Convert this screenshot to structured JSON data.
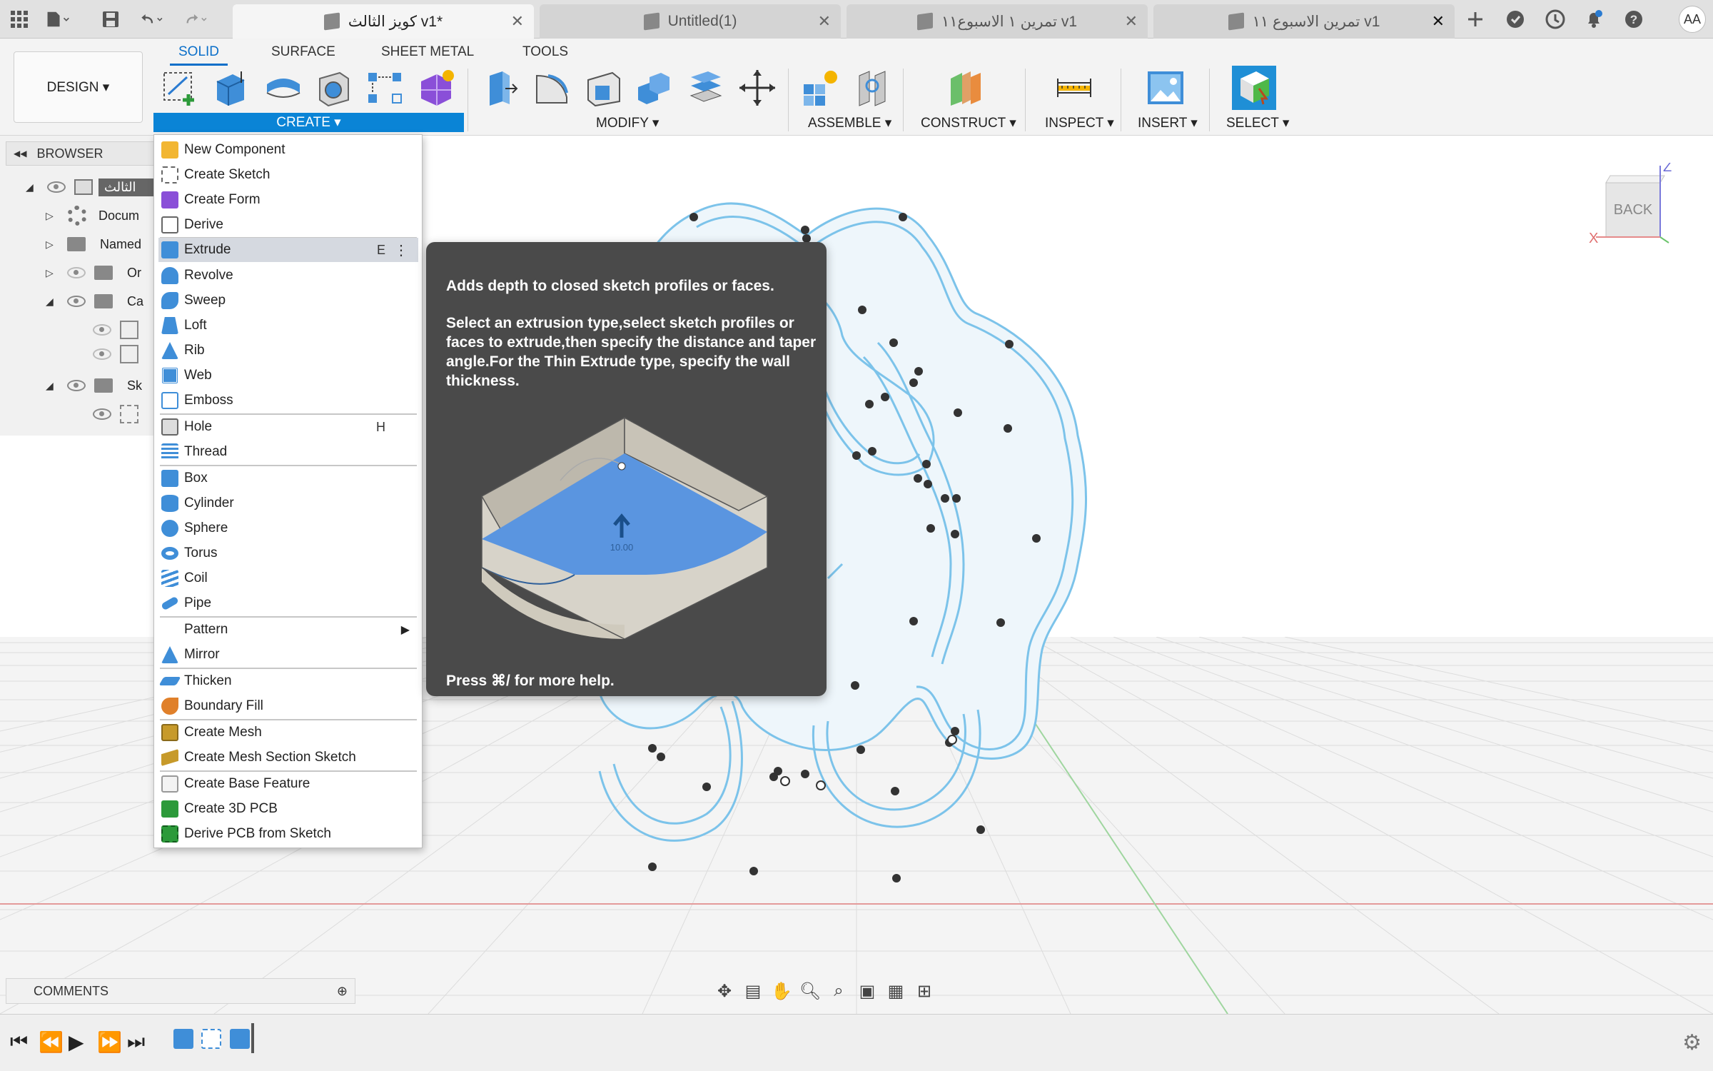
{
  "titlebar": {
    "tabs": [
      {
        "label": "كويز الثالث v1*",
        "active": true
      },
      {
        "label": "Untitled(1)",
        "active": false
      },
      {
        "label": "تمرين ١ الاسبوع١١ v1",
        "active": false
      },
      {
        "label": "تمرين الاسبوع ١١ v1",
        "active": false
      }
    ],
    "close_glyph": "✕",
    "user_initials": "AA"
  },
  "toolbar": {
    "tabs": [
      "SOLID",
      "SURFACE",
      "SHEET METAL",
      "TOOLS"
    ],
    "active_tab": "SOLID",
    "workspace": "DESIGN ▾",
    "groups": {
      "create": "CREATE ▾",
      "modify": "MODIFY ▾",
      "assemble": "ASSEMBLE ▾",
      "construct": "CONSTRUCT ▾",
      "inspect": "INSPECT ▾",
      "insert": "INSERT ▾",
      "select": "SELECT ▾"
    }
  },
  "browser": {
    "title": "BROWSER",
    "collapse_glyph": "◀◀",
    "items": [
      {
        "label": "الثالث",
        "expanded": true
      },
      {
        "label": "Docum"
      },
      {
        "label": "Named"
      },
      {
        "label": "Or"
      },
      {
        "label": "Ca"
      },
      {
        "label": "Sk"
      }
    ]
  },
  "create_menu": {
    "items": [
      {
        "label": "New Component",
        "icon": "new-component-icon",
        "color": "#f2b632"
      },
      {
        "label": "Create Sketch",
        "icon": "sketch-icon",
        "color": "#2c9a3a"
      },
      {
        "label": "Create Form",
        "icon": "form-icon",
        "color": "#8a4fd8"
      },
      {
        "label": "Derive",
        "icon": "derive-icon",
        "color": "#666666"
      },
      {
        "label": "Extrude",
        "icon": "extrude-icon",
        "color": "#3f8ed8",
        "shortcut": "E",
        "highlighted": true
      },
      {
        "label": "Revolve",
        "icon": "revolve-icon",
        "color": "#3f8ed8"
      },
      {
        "label": "Sweep",
        "icon": "sweep-icon",
        "color": "#3f8ed8"
      },
      {
        "label": "Loft",
        "icon": "loft-icon",
        "color": "#3f8ed8"
      },
      {
        "label": "Rib",
        "icon": "rib-icon",
        "color": "#3f8ed8"
      },
      {
        "label": "Web",
        "icon": "web-icon",
        "color": "#3f8ed8"
      },
      {
        "label": "Emboss",
        "icon": "emboss-icon",
        "color": "#3f8ed8"
      },
      {
        "label": "Hole",
        "icon": "hole-icon",
        "color": "#3f8ed8",
        "shortcut": "H"
      },
      {
        "label": "Thread",
        "icon": "thread-icon",
        "color": "#3f8ed8"
      },
      {
        "label": "Box",
        "icon": "box-icon",
        "color": "#3f8ed8"
      },
      {
        "label": "Cylinder",
        "icon": "cylinder-icon",
        "color": "#3f8ed8"
      },
      {
        "label": "Sphere",
        "icon": "sphere-icon",
        "color": "#3f8ed8"
      },
      {
        "label": "Torus",
        "icon": "torus-icon",
        "color": "#3f8ed8"
      },
      {
        "label": "Coil",
        "icon": "coil-icon",
        "color": "#3f8ed8"
      },
      {
        "label": "Pipe",
        "icon": "pipe-icon",
        "color": "#3f8ed8"
      },
      {
        "label": "Pattern",
        "icon": "",
        "color": "",
        "submenu": true
      },
      {
        "label": "Mirror",
        "icon": "mirror-icon",
        "color": "#3f8ed8"
      },
      {
        "label": "Thicken",
        "icon": "thicken-icon",
        "color": "#3f8ed8"
      },
      {
        "label": "Boundary Fill",
        "icon": "boundary-fill-icon",
        "color": "#e0802a"
      },
      {
        "label": "Create Mesh",
        "icon": "create-mesh-icon",
        "color": "#c79a2a"
      },
      {
        "label": "Create Mesh Section Sketch",
        "icon": "mesh-section-sketch-icon",
        "color": "#c79a2a"
      },
      {
        "label": "Create Base Feature",
        "icon": "base-feature-icon",
        "color": "#e8e8e8"
      },
      {
        "label": "Create 3D PCB",
        "icon": "pcb-icon",
        "color": "#2c9a3a"
      },
      {
        "label": "Derive PCB from Sketch",
        "icon": "derive-pcb-icon",
        "color": "#2c9a3a"
      }
    ],
    "more_glyph": "⋮",
    "submenu_glyph": "▶"
  },
  "tooltip": {
    "title": "Adds depth to closed sketch profiles or faces.",
    "body": "Select an extrusion type,select sketch profiles or faces to extrude,then specify the distance and taper angle.For the Thin Extrude type, specify the wall thickness.",
    "illustration_value": "10.00",
    "footer": "Press ⌘/ for more help."
  },
  "viewcube": {
    "face": "BACK",
    "z_axis": "Z",
    "x_axis": "X"
  },
  "comments": {
    "label": "COMMENTS",
    "add_glyph": "⊕"
  },
  "colors": {
    "accent": "#0a84d6",
    "sketch_line": "#7cc3ea",
    "sketch_fill": "#eef6fb",
    "tooltip_bg": "#4a4a4a"
  }
}
